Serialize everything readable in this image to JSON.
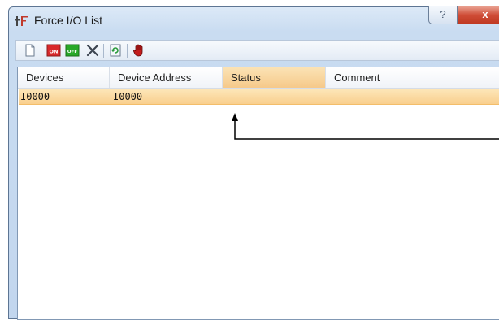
{
  "window": {
    "title": "Force I/O List",
    "help_label": "?",
    "close_label": "x"
  },
  "toolbar": {
    "buttons": [
      {
        "icon": "new-document-icon"
      },
      {
        "icon": "force-on-icon",
        "label": "ON",
        "color": "#d8282a"
      },
      {
        "icon": "force-off-icon",
        "label": "OFF",
        "color": "#28a828"
      },
      {
        "icon": "delete-x-icon"
      },
      {
        "icon": "refresh-icon"
      },
      {
        "icon": "stop-hand-icon"
      }
    ]
  },
  "list": {
    "columns": [
      "Devices",
      "Device Address",
      "Status",
      "Comment"
    ],
    "rows": [
      {
        "device": "I0000",
        "address": "I0000",
        "status": "-",
        "comment": ""
      }
    ]
  },
  "colors": {
    "selection": "#f9cf8e",
    "sorted_header": "#f6c98a",
    "titlebar": "#c9dcf1"
  }
}
